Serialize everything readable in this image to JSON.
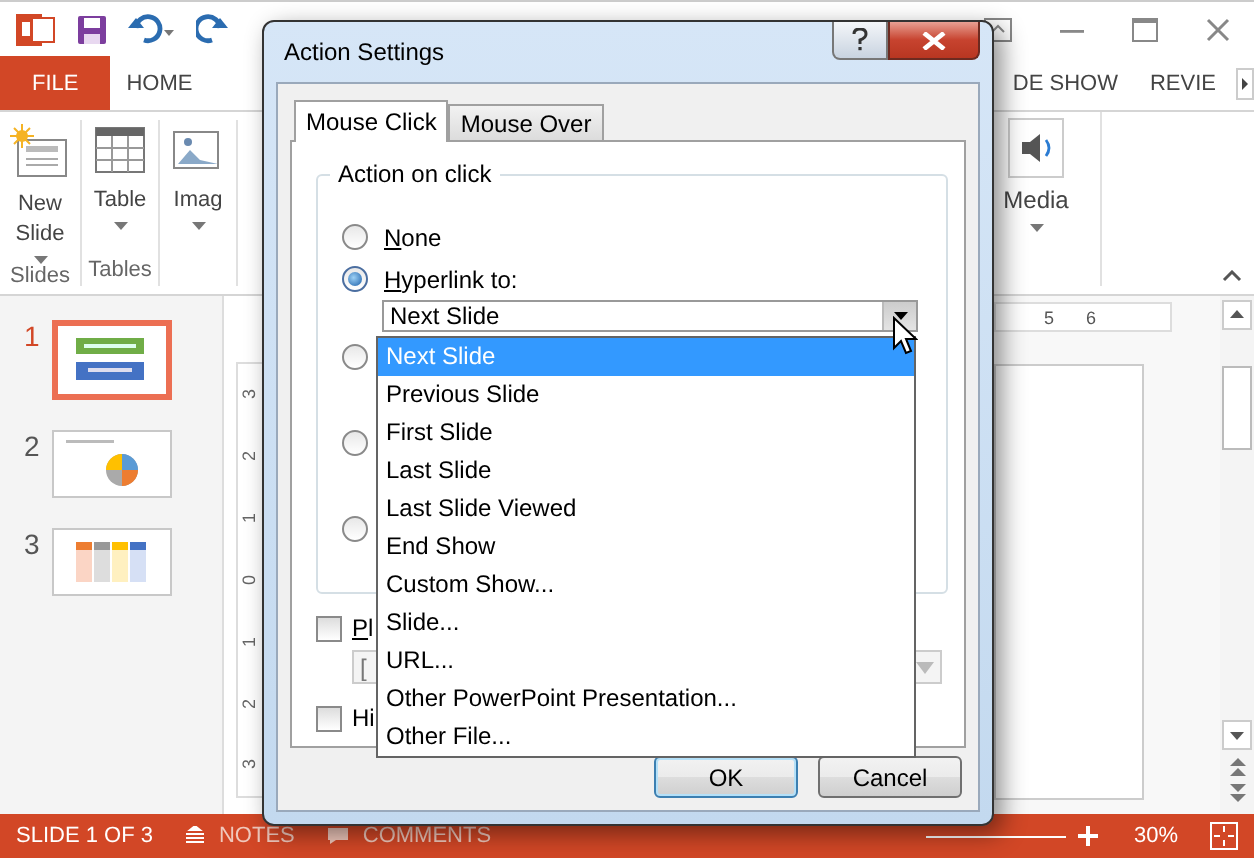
{
  "ribbon_tabs": [
    {
      "label": "FILE",
      "kind": "file"
    },
    {
      "label": "HOME",
      "kind": "tab"
    },
    {
      "label": "DE SHOW",
      "kind": "tab"
    },
    {
      "label": "REVIE",
      "kind": "tab"
    }
  ],
  "ribbon_groups": [
    {
      "label": "Slides",
      "buttons": [
        {
          "label": "New",
          "label2": "Slide",
          "kind": "new-slide",
          "dropdown": true
        }
      ]
    },
    {
      "label": "Tables",
      "buttons": [
        {
          "label": "Table",
          "kind": "table",
          "dropdown": true
        }
      ]
    },
    {
      "buttons": [
        {
          "label": "Imag",
          "kind": "picture",
          "dropdown": true
        }
      ]
    }
  ],
  "media_button": {
    "label": "Media",
    "dropdown": true
  },
  "slides": [
    {
      "number": "1",
      "selected": true,
      "kind": "title"
    },
    {
      "number": "2",
      "selected": false,
      "kind": "pie"
    },
    {
      "number": "3",
      "selected": false,
      "kind": "columns"
    }
  ],
  "vertical_ruler": [
    "3",
    "2",
    "1",
    "0",
    "1",
    "2",
    "3"
  ],
  "horizontal_ruler": [
    "5",
    "6"
  ],
  "status_bar": {
    "slide": "SLIDE 1 OF 3",
    "notes": "NOTES",
    "comments": "COMMENTS",
    "zoom": "30%"
  },
  "dialog": {
    "title": "Action Settings",
    "tabs": [
      {
        "label": "Mouse Click",
        "selected": true
      },
      {
        "label": "Mouse Over",
        "selected": false
      }
    ],
    "group_title": "Action on click",
    "radios": [
      {
        "label": "None",
        "selected": false,
        "underline_first": true
      },
      {
        "label": "Hyperlink to:",
        "selected": true,
        "underline_first": true
      },
      {
        "selected": false
      },
      {
        "selected": false
      },
      {
        "selected": false
      }
    ],
    "hyperlink_select": {
      "value": "Next Slide",
      "expanded": true,
      "options": [
        {
          "label": "Next Slide",
          "selected": true
        },
        {
          "label": "Previous Slide",
          "selected": false
        },
        {
          "label": "First Slide",
          "selected": false
        },
        {
          "label": "Last Slide",
          "selected": false
        },
        {
          "label": "Last Slide Viewed",
          "selected": false
        },
        {
          "label": "End Show",
          "selected": false
        },
        {
          "label": "Custom Show...",
          "selected": false
        },
        {
          "label": "Slide...",
          "selected": false
        },
        {
          "label": "URL...",
          "selected": false
        },
        {
          "label": "Other PowerPoint Presentation...",
          "selected": false
        },
        {
          "label": "Other File...",
          "selected": false
        }
      ]
    },
    "play_sound": {
      "label": "Pl",
      "checked": false,
      "underline_first": true
    },
    "sound_select": {
      "value": "["
    },
    "highlight": {
      "label": "Hi",
      "checked": false
    },
    "buttons": [
      {
        "label": "OK",
        "kind": "default"
      },
      {
        "label": "Cancel",
        "kind": "normal"
      }
    ]
  }
}
